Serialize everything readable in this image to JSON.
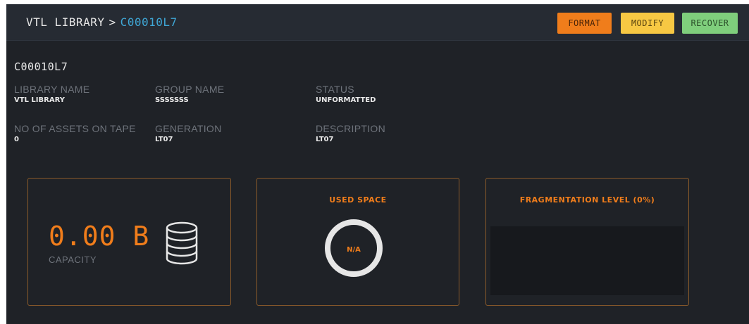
{
  "header": {
    "breadcrumb_root": "VTL LIBRARY",
    "breadcrumb_sep": ">",
    "breadcrumb_current": "C00010L7",
    "buttons": {
      "format": "FORMAT",
      "modify": "MODIFY",
      "recover": "RECOVER"
    }
  },
  "detail": {
    "title": "C00010L7",
    "fields": {
      "library_name": {
        "label": "LIBRARY NAME",
        "value": "VTL LIBRARY"
      },
      "group_name": {
        "label": "GROUP NAME",
        "value": "SSSSSSS"
      },
      "status": {
        "label": "STATUS",
        "value": "UNFORMATTED"
      },
      "assets": {
        "label": "NO OF ASSETS ON TAPE",
        "value": "0"
      },
      "generation": {
        "label": "GENERATION",
        "value": "LT07"
      },
      "description": {
        "label": "DESCRIPTION",
        "value": "LT07"
      }
    }
  },
  "cards": {
    "capacity": {
      "value": "0.00 B",
      "label": "CAPACITY",
      "icon": "database-icon"
    },
    "used_space": {
      "title": "USED SPACE",
      "value": "N/A"
    },
    "fragmentation": {
      "title": "FRAGMENTATION LEVEL (0%)"
    }
  },
  "colors": {
    "accent": "#f07d1b",
    "link": "#3fa7d6",
    "format_btn": "#f07d1b",
    "modify_btn": "#f7c843",
    "recover_btn": "#7fce7c",
    "background": "#1f2227"
  }
}
